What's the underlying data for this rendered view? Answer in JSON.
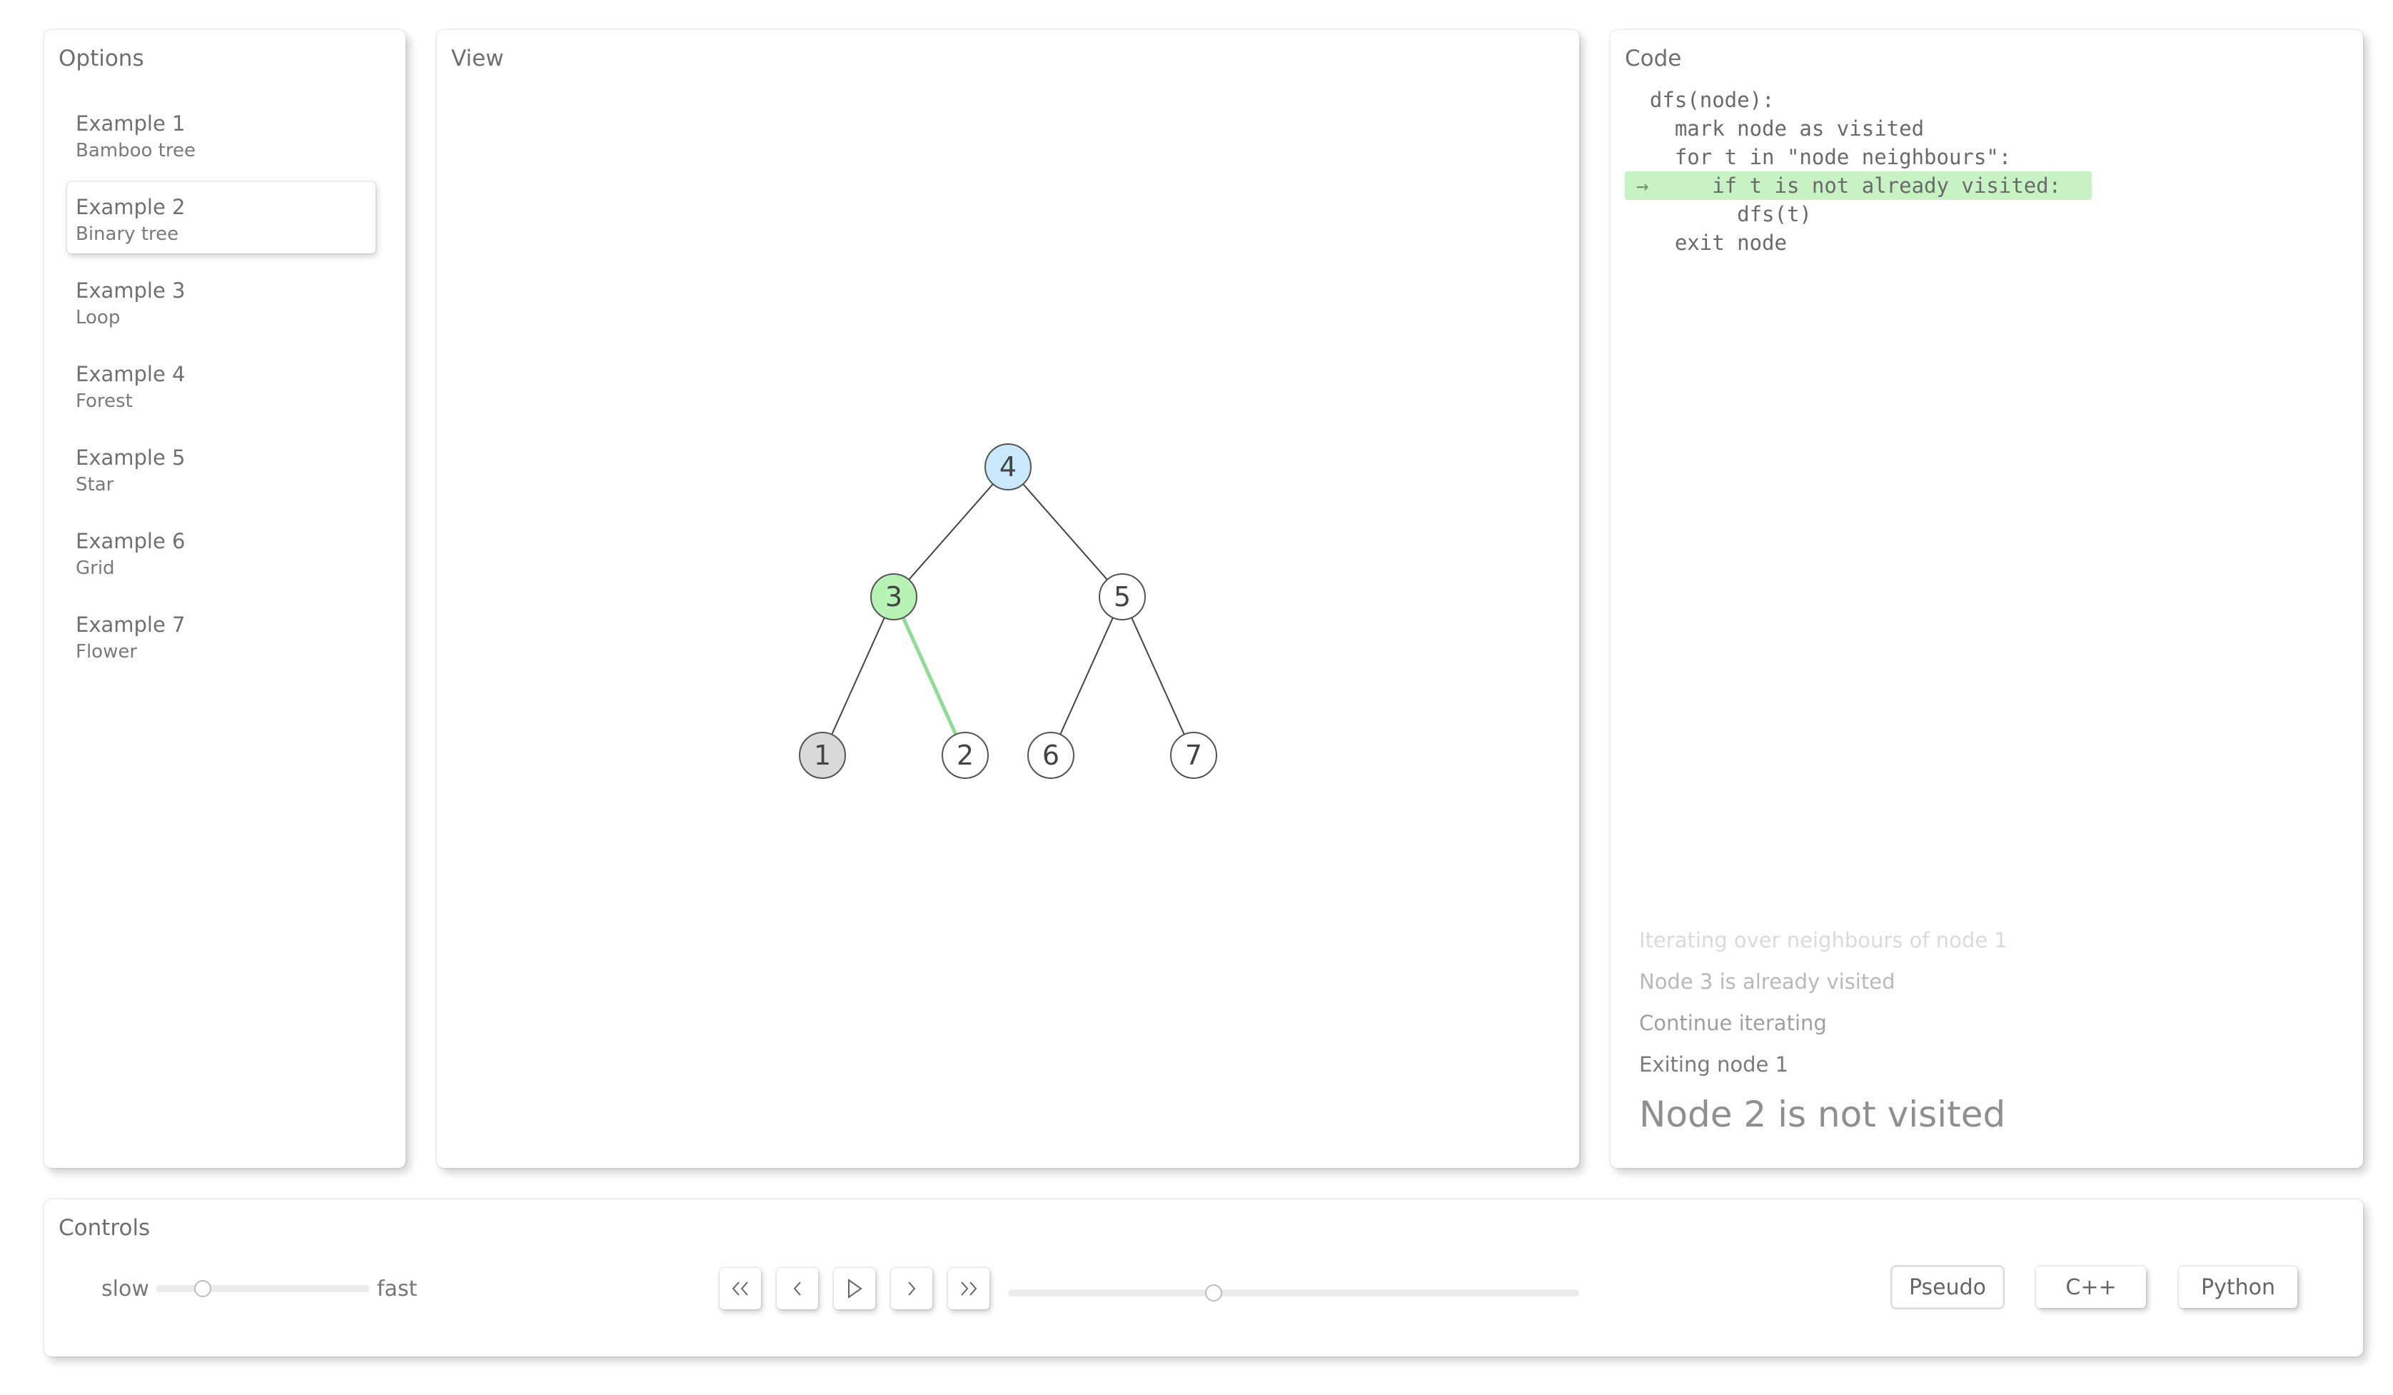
{
  "options": {
    "title": "Options",
    "selected_index": 1,
    "items": [
      {
        "title": "Example 1",
        "subtitle": "Bamboo tree"
      },
      {
        "title": "Example 2",
        "subtitle": "Binary tree"
      },
      {
        "title": "Example 3",
        "subtitle": "Loop"
      },
      {
        "title": "Example 4",
        "subtitle": "Forest"
      },
      {
        "title": "Example 5",
        "subtitle": "Star"
      },
      {
        "title": "Example 6",
        "subtitle": "Grid"
      },
      {
        "title": "Example 7",
        "subtitle": "Flower"
      }
    ]
  },
  "view": {
    "title": "View",
    "colors": {
      "current": "#c9e8fb",
      "active": "#b7f3b4",
      "visited": "#d9d9d9",
      "unvisited": "#ffffff",
      "active_edge": "#8fdc96",
      "edge": "#444444"
    },
    "nodes": [
      {
        "id": "4",
        "state": "current"
      },
      {
        "id": "3",
        "state": "active"
      },
      {
        "id": "5",
        "state": "unvisited"
      },
      {
        "id": "1",
        "state": "visited"
      },
      {
        "id": "2",
        "state": "unvisited"
      },
      {
        "id": "6",
        "state": "unvisited"
      },
      {
        "id": "7",
        "state": "unvisited"
      }
    ],
    "edges": [
      {
        "from": "4",
        "to": "3",
        "highlight": false
      },
      {
        "from": "4",
        "to": "5",
        "highlight": false
      },
      {
        "from": "3",
        "to": "1",
        "highlight": false
      },
      {
        "from": "3",
        "to": "2",
        "highlight": true
      },
      {
        "from": "5",
        "to": "6",
        "highlight": false
      },
      {
        "from": "5",
        "to": "7",
        "highlight": false
      }
    ]
  },
  "code": {
    "title": "Code",
    "arrow": "→",
    "highlight_index": 3,
    "highlight_color": "#c7f2c4",
    "lines": [
      "  dfs(node):",
      "    mark node as visited",
      "    for t in \"node neighbours\":",
      "       if t is not already visited:",
      "         dfs(t)",
      "    exit node"
    ],
    "log": [
      "Iterating over neighbours of node 1",
      "Node 3 is already visited",
      "Continue iterating",
      "Exiting node 1"
    ],
    "current_message": "Node 2 is not visited"
  },
  "controls": {
    "title": "Controls",
    "speed": {
      "slow_label": "slow",
      "fast_label": "fast",
      "value": 0.22
    },
    "progress": {
      "value": 0.36
    },
    "nav_icons": [
      "first-step-icon",
      "prev-step-icon",
      "play-icon",
      "next-step-icon",
      "last-step-icon"
    ],
    "languages": [
      {
        "label": "Pseudo",
        "active": true
      },
      {
        "label": "C++",
        "active": false
      },
      {
        "label": "Python",
        "active": false
      }
    ]
  }
}
